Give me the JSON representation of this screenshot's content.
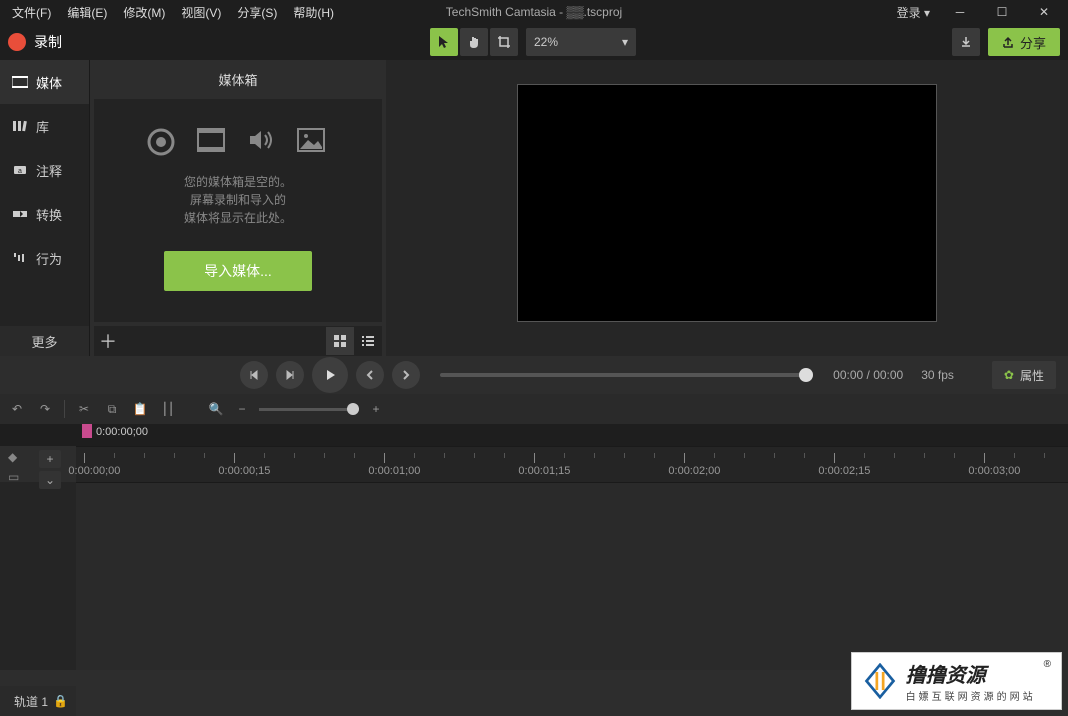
{
  "menubar": {
    "items": [
      "文件(F)",
      "编辑(E)",
      "修改(M)",
      "视图(V)",
      "分享(S)",
      "帮助(H)"
    ],
    "title": "TechSmith Camtasia - ▒▒.tscproj",
    "login": "登录 ▾"
  },
  "record": {
    "label": "录制"
  },
  "tools": {
    "zoom": "22%"
  },
  "share": {
    "label": "分享"
  },
  "sidebar": {
    "items": [
      {
        "label": "媒体"
      },
      {
        "label": "库"
      },
      {
        "label": "注释"
      },
      {
        "label": "转换"
      },
      {
        "label": "行为"
      }
    ],
    "more": "更多"
  },
  "panel": {
    "title": "媒体箱",
    "empty_lines": [
      "您的媒体箱是空的。",
      "屏幕录制和导入的",
      "媒体将显示在此处。"
    ],
    "import": "导入媒体..."
  },
  "playback": {
    "time": "00:00 / 00:00",
    "fps": "30 fps",
    "props": "属性"
  },
  "timeline": {
    "playhead_time": "0:00:00;00",
    "labels": [
      "0:00:00;00",
      "0:00:00;15",
      "0:00:01;00",
      "0:00:01;15",
      "0:00:02;00",
      "0:00:02;15",
      "0:00:03;00"
    ],
    "track1": "轨道 1"
  },
  "watermark": {
    "main": "撸撸资源",
    "sub": "白嫖互联网资源的网站",
    "r": "®"
  }
}
